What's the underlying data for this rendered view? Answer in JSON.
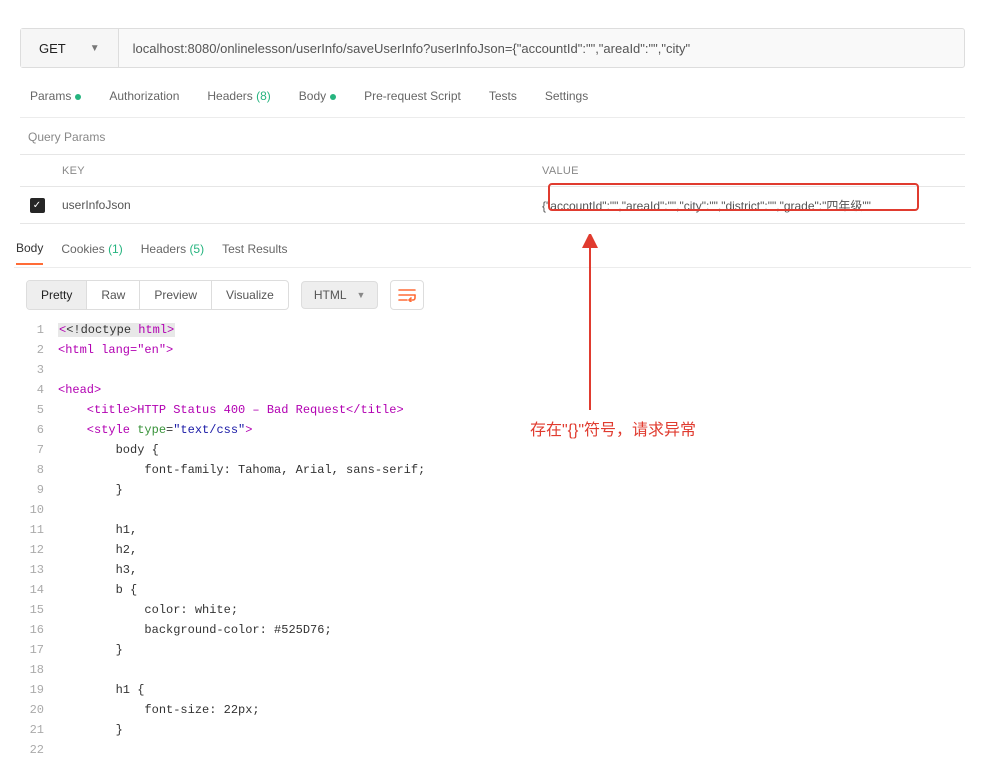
{
  "request": {
    "method": "GET",
    "url": "localhost:8080/onlinelesson/userInfo/saveUserInfo?userInfoJson={\"accountId\":\"\",\"areaId\":\"\",\"city\""
  },
  "reqTabs": {
    "params": "Params",
    "authorization": "Authorization",
    "headers": "Headers",
    "headersCount": "(8)",
    "body": "Body",
    "prescript": "Pre-request Script",
    "tests": "Tests",
    "settings": "Settings"
  },
  "queryParamsLabel": "Query Params",
  "paramsTable": {
    "keyHeader": "KEY",
    "valueHeader": "VALUE",
    "row": {
      "key": "userInfoJson",
      "value": "{\"accountId\":\"\",\"areaId\":\"\",\"city\":\"\",\"district\":\"\",\"grade\":\"四年级\"\""
    }
  },
  "respTabs": {
    "body": "Body",
    "cookies": "Cookies",
    "cookiesCount": "(1)",
    "headers": "Headers",
    "headersCount": "(5)",
    "testResults": "Test Results"
  },
  "formatBar": {
    "pretty": "Pretty",
    "raw": "Raw",
    "preview": "Preview",
    "visualize": "Visualize",
    "html": "HTML"
  },
  "code": {
    "l1a": "<!doctype ",
    "l1b": "html",
    "l1c": ">",
    "l2": "<html lang=\"en\">",
    "l4": "<head>",
    "l5": "    <title>HTTP Status 400 – Bad Request</title>",
    "l6a": "    <style ",
    "l6attr": "type",
    "l6eq": "=",
    "l6str": "\"text/css\"",
    "l6c": ">",
    "l7": "        body {",
    "l8": "            font-family: Tahoma, Arial, sans-serif;",
    "l9": "        }",
    "l11": "        h1,",
    "l12": "        h2,",
    "l13": "        h3,",
    "l14": "        b {",
    "l15": "            color: white;",
    "l16": "            background-color: #525D76;",
    "l17": "        }",
    "l19": "        h1 {",
    "l20": "            font-size: 22px;",
    "l21": "        }"
  },
  "annotation": "存在\"{}\"符号，请求异常"
}
